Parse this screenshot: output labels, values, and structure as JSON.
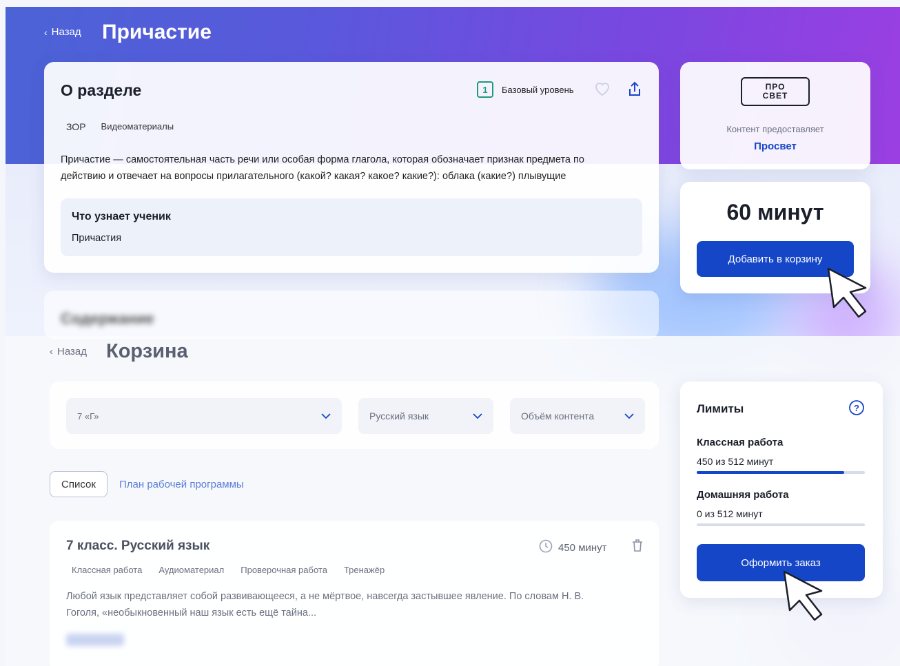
{
  "top": {
    "back_label": "Назад",
    "page_title": "Причастие"
  },
  "about": {
    "heading": "О разделе",
    "level_number": "1",
    "level_label": "Базовый уровень",
    "tags": [
      "ЗОР",
      "Видеоматериалы"
    ],
    "description_line1": "Причастие — самостоятельная часть речи или особая форма глагола, которая обозначает признак предмета по",
    "description_line2": "действию и отвечает на вопросы прилагательного (какой? какая? какое? какие?): облака (какие?) плывущие",
    "learn_heading": "Что узнает ученик",
    "learn_value": "Причастия",
    "next_section_blurred": "Содержание"
  },
  "provider": {
    "logo_top": "ПРО",
    "logo_bottom": "СВЕТ",
    "caption": "Контент предоставляет",
    "name": "Просвет"
  },
  "buy": {
    "duration": "60 минут",
    "add_button": "Добавить в корзину"
  },
  "cart": {
    "back_label": "Назад",
    "title": "Корзина",
    "filters": {
      "class_value": "7 «Г»",
      "subject_value": "Русский язык",
      "volume_placeholder": "Объём контента"
    },
    "view_tabs": {
      "list": "Список",
      "plan": "План рабочей программы"
    },
    "item": {
      "title": "7 класс. Русский язык",
      "minutes": "450 минут",
      "tags": [
        "Классная работа",
        "Аудиоматериал",
        "Проверочная работа",
        "Тренажёр"
      ],
      "text_line1": "Любой язык представляет собой развивающееся, а не мёртвое, навсегда застывшее явление. По словам Н. В.",
      "text_line2": "Гоголя, «необыкновенный наш язык есть ещё тайна..."
    }
  },
  "limits": {
    "heading": "Лимиты",
    "class_work_label": "Классная работа",
    "class_work_value": "450 из 512 минут",
    "class_work_fraction": 0.879,
    "home_work_label": "Домашняя работа",
    "home_work_value": "0 из 512 минут",
    "home_work_fraction": 0,
    "order_button": "Оформить заказ"
  },
  "colors": {
    "accent": "#1646c8",
    "banner_start": "#4b63d6",
    "banner_end": "#9b3fe2",
    "level_badge": "#1f9a7a"
  }
}
